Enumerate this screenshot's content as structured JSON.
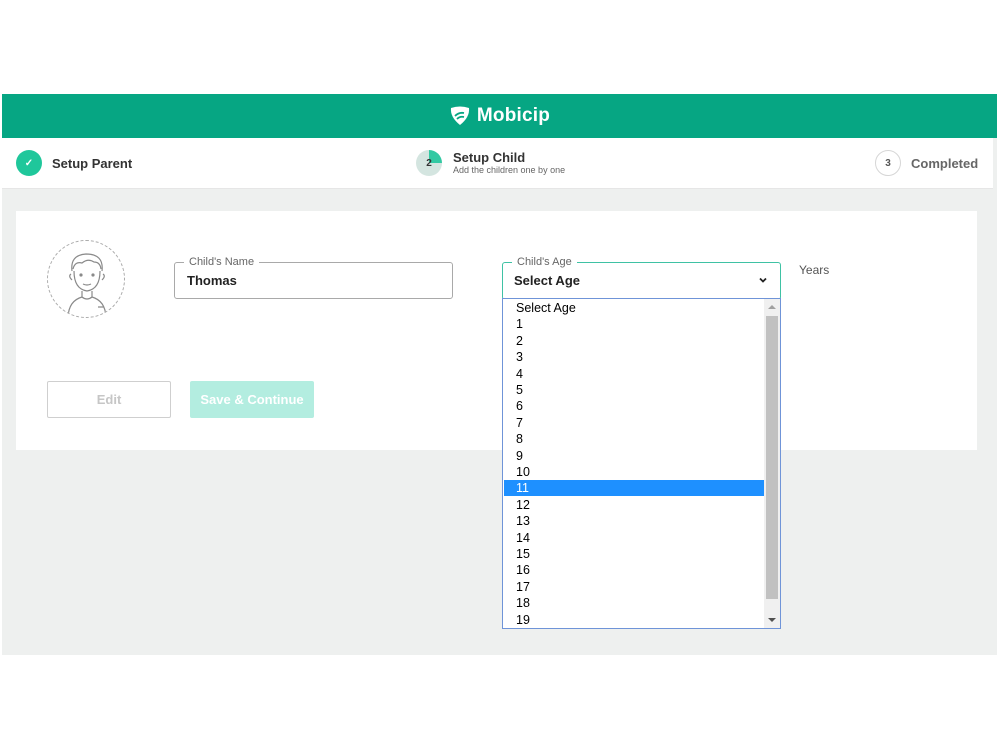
{
  "header": {
    "brand": "Mobicip"
  },
  "steps": [
    {
      "number": "✓",
      "label": "Setup Parent",
      "state": "done"
    },
    {
      "number": "2",
      "label": "Setup Child",
      "sublabel": "Add the children one by one",
      "state": "current"
    },
    {
      "number": "3",
      "label": "Completed",
      "state": "pending"
    }
  ],
  "form": {
    "name_label": "Child's Name",
    "name_value": "Thomas",
    "age_label": "Child's Age",
    "age_value": "Select Age",
    "age_unit": "Years",
    "age_options": [
      "Select Age",
      "1",
      "2",
      "3",
      "4",
      "5",
      "6",
      "7",
      "8",
      "9",
      "10",
      "11",
      "12",
      "13",
      "14",
      "15",
      "16",
      "17",
      "18",
      "19"
    ],
    "highlighted_option": "11"
  },
  "buttons": {
    "edit": "Edit",
    "save": "Save & Continue"
  },
  "colors": {
    "brand": "#06a683",
    "accent": "#1fc79b",
    "highlight": "#1e90ff"
  }
}
